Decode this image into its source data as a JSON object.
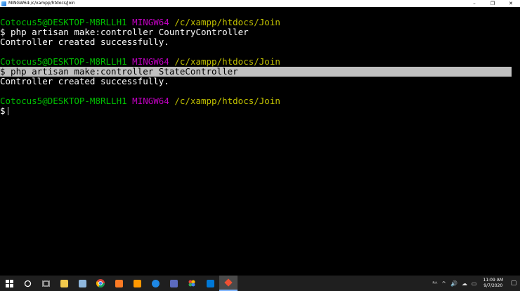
{
  "window": {
    "title": "MINGW64:/c/xampp/htdocs/Join",
    "controls": {
      "minimize": "–",
      "maximize": "❐",
      "close": "✕"
    }
  },
  "terminal": {
    "blocks": [
      {
        "prompt": {
          "user": "Cotocus5@DESKTOP-M8RLLH1",
          "env": "MINGW64",
          "path": "/c/xampp/htdocs/Join"
        },
        "command": "$ php artisan make:controller CountryController",
        "output": "Controller created successfully."
      },
      {
        "prompt": {
          "user": "Cotocus5@DESKTOP-M8RLLH1",
          "env": "MINGW64",
          "path": "/c/xampp/htdocs/Join"
        },
        "command": "$ php artisan make:controller StateController",
        "output": "Controller created successfully."
      },
      {
        "prompt": {
          "user": "Cotocus5@DESKTOP-M8RLLH1",
          "env": "MINGW64",
          "path": "/c/xampp/htdocs/Join"
        },
        "command": "$"
      }
    ]
  },
  "taskbar": {
    "clock_time": "11:09 AM",
    "clock_date": "9/7/2020",
    "icons": [
      "windows-start-icon",
      "search-icon",
      "task-view-icon",
      "file-explorer-icon",
      "notepad-icon",
      "chrome-icon",
      "xampp-icon",
      "sublime-text-icon",
      "maps-icon",
      "network-app-icon",
      "photos-app-icon",
      "mail-icon",
      "git-bash-icon"
    ],
    "tray": {
      "people": "ᴿᴬ",
      "chevron": "^",
      "volume": "🔊",
      "cloud": "☁",
      "network": "▭"
    },
    "notifications": "▢"
  },
  "colors": {
    "terminal_bg": "#000000",
    "user_host": "#00c000",
    "env": "#c000c0",
    "path": "#c0c000",
    "selection_bg": "#c0c0c0",
    "taskbar_bg": "#1f1f1f"
  }
}
